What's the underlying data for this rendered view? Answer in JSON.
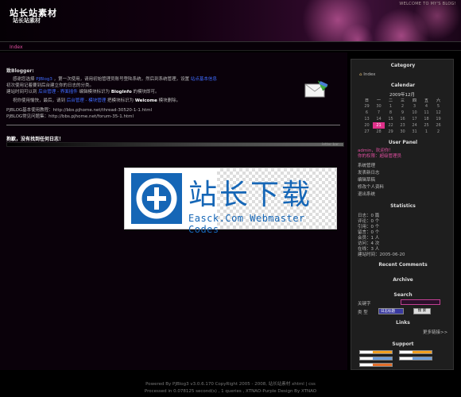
{
  "header": {
    "site_title": "站长站素材",
    "site_subtitle": "站长站素材",
    "welcome": "WELCOME TO MY'S BLOG!"
  },
  "nav": {
    "index": "Index"
  },
  "post": {
    "title": "致Blogger:",
    "line1a": "感谢您选择",
    "line1b": "PJBlog3",
    "line1c": "，第一次使用，请用初始管理员账号登陆系统，然后到系统管理，设置",
    "line1d": "站点基本信息",
    "line2": "初次使用记着要到后台建立你的日志的分类。",
    "line3a": "建站时间可以到",
    "line3b": "后台管理",
    "line3c": "-",
    "line3d": "界面插件",
    "line3e": "编辑模块标识为",
    "line3f": "BlogInfo",
    "line3g": "的模块即可。",
    "line4a": "祝你使用愉快，最后，请到",
    "line4b": "后台管理",
    "line4c": "-",
    "line4d": "模块管理",
    "line4e": "把模块标识为",
    "line4f": "Welcome",
    "line4g": "模块删除。",
    "link1": "PJBLOG基本使用教程：http://bbs.pjhome.net/thread-30520-1-1.html",
    "link2": "PJBLOG常见问题集：http://bbs.pjhome.net/forum-35-1.html"
  },
  "notfound": {
    "text": "抱歉，没有找到任何日志！",
    "bar_label": "letter bar"
  },
  "logo": {
    "cn": "站长下载",
    "en": "Easck.Com Webmaster Codes"
  },
  "sidebar": {
    "category_title": "Category",
    "category_index": "Index",
    "calendar_title": "Calendar",
    "calendar_month": "2009年12月",
    "calendar_head": [
      "日",
      "一",
      "二",
      "三",
      "四",
      "五",
      "六"
    ],
    "calendar_rows": [
      [
        "29",
        "30",
        "1",
        "2",
        "3",
        "4",
        "5"
      ],
      [
        "6",
        "7",
        "8",
        "9",
        "10",
        "11",
        "12"
      ],
      [
        "13",
        "14",
        "15",
        "16",
        "17",
        "18",
        "19"
      ],
      [
        "20",
        "21",
        "22",
        "23",
        "24",
        "25",
        "26"
      ],
      [
        "27",
        "28",
        "29",
        "30",
        "31",
        "1",
        "2"
      ]
    ],
    "calendar_today": "21",
    "user_title": "User Panel",
    "user_welcome": "admin，欢迎你！",
    "user_perm": "你的权限：超级管理员",
    "user_links": [
      "系统管理",
      "发表新日志",
      "编辑草稿",
      "修改个人资料",
      "退出系统"
    ],
    "stats_title": "Statistics",
    "stats": [
      "日志：0 篇",
      "评论：0 个",
      "引用：0 个",
      "留言：0 个",
      "会员：1 人",
      "访问：4 次",
      "在线：3 人"
    ],
    "stats_built": "建站时间：2005-06-20",
    "comments_title": "Recent Comments",
    "archive_title": "Archive",
    "search_title": "Search",
    "search_keyword": "关键字",
    "search_type": "类  型",
    "search_select": "日志标题",
    "search_button": "搜 索",
    "links_title": "Links",
    "links_more": "更多链接>>",
    "support_title": "Support"
  },
  "footer": {
    "line1": "Powered By PJBlog3 v3.0.6.170 CopyRight 2005 - 2008, 站长站素材  xhtml | css",
    "line2": "Processed in 0.078125 second(s) , 1 queries , XTNAO-Purple Design By XTNAO"
  },
  "colors": {
    "accent": "#e04fa0",
    "link": "#3f6bff",
    "logo_blue": "#1566b6"
  }
}
